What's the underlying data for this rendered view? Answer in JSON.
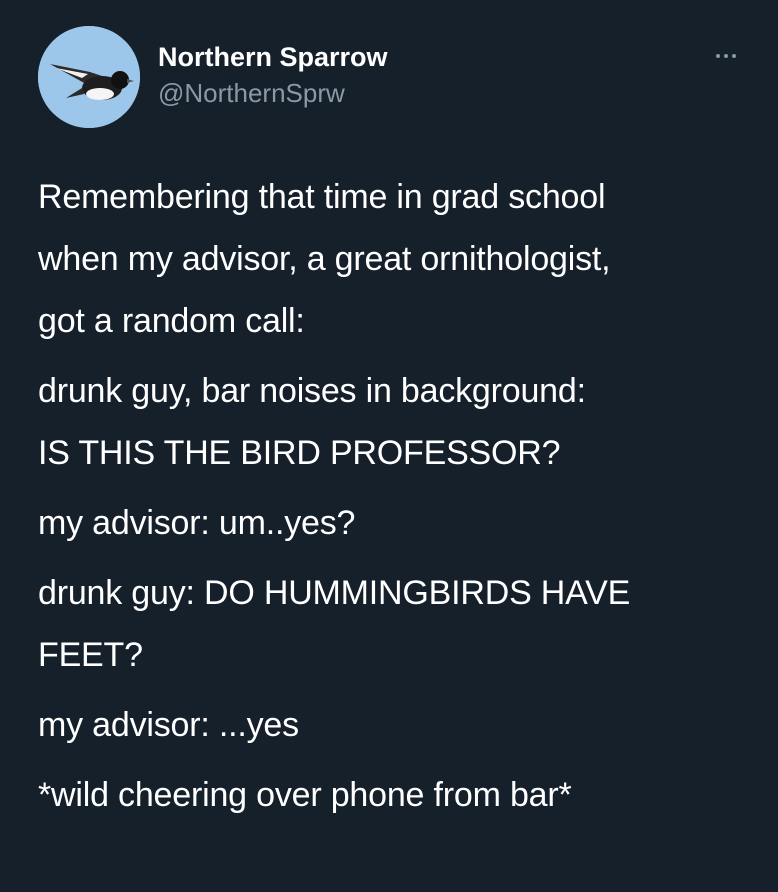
{
  "user": {
    "display_name": "Northern Sparrow",
    "handle": "@NorthernSprw",
    "avatar": "bird-avatar"
  },
  "more_icon": "more-options-icon",
  "tweet": {
    "paragraphs": [
      {
        "lines": [
          "Remembering that time in grad school",
          "when my advisor, a great ornithologist,",
          "got a random call:"
        ]
      },
      {
        "lines": [
          "drunk guy, bar noises in background:",
          "IS THIS THE BIRD PROFESSOR?"
        ]
      },
      {
        "lines": [
          "my advisor: um..yes?"
        ]
      },
      {
        "lines": [
          "drunk guy: DO HUMMINGBIRDS HAVE",
          "FEET?"
        ]
      },
      {
        "lines": [
          "my advisor: ...yes"
        ]
      },
      {
        "lines": [
          "*wild cheering over phone from bar*"
        ]
      }
    ]
  },
  "colors": {
    "background": "#15202b",
    "text": "#ffffff",
    "secondary": "#8b98a5",
    "avatar_sky": "#9cc7ea"
  }
}
